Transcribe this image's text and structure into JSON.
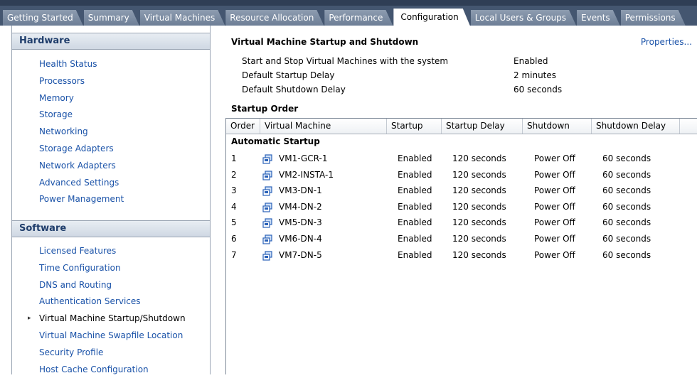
{
  "tabs": [
    {
      "label": "Getting Started"
    },
    {
      "label": "Summary"
    },
    {
      "label": "Virtual Machines"
    },
    {
      "label": "Resource Allocation"
    },
    {
      "label": "Performance"
    },
    {
      "label": "Configuration"
    },
    {
      "label": "Local Users & Groups"
    },
    {
      "label": "Events"
    },
    {
      "label": "Permissions"
    }
  ],
  "active_tab": "Configuration",
  "hardware": {
    "header": "Hardware",
    "items": [
      "Health Status",
      "Processors",
      "Memory",
      "Storage",
      "Networking",
      "Storage Adapters",
      "Network Adapters",
      "Advanced Settings",
      "Power Management"
    ]
  },
  "software": {
    "header": "Software",
    "items": [
      "Licensed Features",
      "Time Configuration",
      "DNS and Routing",
      "Authentication Services",
      "Virtual Machine Startup/Shutdown",
      "Virtual Machine Swapfile Location",
      "Security Profile",
      "Host Cache Configuration"
    ],
    "current": "Virtual Machine Startup/Shutdown"
  },
  "main": {
    "title": "Virtual Machine Startup and Shutdown",
    "properties_link": "Properties...",
    "settings": [
      {
        "label": "Start and Stop Virtual Machines with the system",
        "value": "Enabled"
      },
      {
        "label": "Default Startup Delay",
        "value": "2 minutes"
      },
      {
        "label": "Default Shutdown Delay",
        "value": "60 seconds"
      }
    ],
    "startup_order_title": "Startup Order",
    "columns": [
      "Order",
      "Virtual Machine",
      "Startup",
      "Startup Delay",
      "Shutdown",
      "Shutdown Delay"
    ],
    "group_label": "Automatic Startup",
    "rows": [
      {
        "order": "1",
        "vm": "VM1-GCR-1",
        "startup": "Enabled",
        "startup_delay": "120 seconds",
        "shutdown": "Power Off",
        "shutdown_delay": "60 seconds"
      },
      {
        "order": "2",
        "vm": "VM2-INSTA-1",
        "startup": "Enabled",
        "startup_delay": "120 seconds",
        "shutdown": "Power Off",
        "shutdown_delay": "60 seconds"
      },
      {
        "order": "3",
        "vm": "VM3-DN-1",
        "startup": "Enabled",
        "startup_delay": "120 seconds",
        "shutdown": "Power Off",
        "shutdown_delay": "60 seconds"
      },
      {
        "order": "4",
        "vm": "VM4-DN-2",
        "startup": "Enabled",
        "startup_delay": "120 seconds",
        "shutdown": "Power Off",
        "shutdown_delay": "60 seconds"
      },
      {
        "order": "5",
        "vm": "VM5-DN-3",
        "startup": "Enabled",
        "startup_delay": "120 seconds",
        "shutdown": "Power Off",
        "shutdown_delay": "60 seconds"
      },
      {
        "order": "6",
        "vm": "VM6-DN-4",
        "startup": "Enabled",
        "startup_delay": "120 seconds",
        "shutdown": "Power Off",
        "shutdown_delay": "60 seconds"
      },
      {
        "order": "7",
        "vm": "VM7-DN-5",
        "startup": "Enabled",
        "startup_delay": "120 seconds",
        "shutdown": "Power Off",
        "shutdown_delay": "60 seconds"
      }
    ]
  },
  "icons": {
    "vm_icon": "virtual-machine-icon",
    "current_arrow": "triangle-right-icon"
  },
  "colors": {
    "link": "#1a52a8",
    "tabbar": "#445670",
    "header_text": "#1f3d6b"
  }
}
